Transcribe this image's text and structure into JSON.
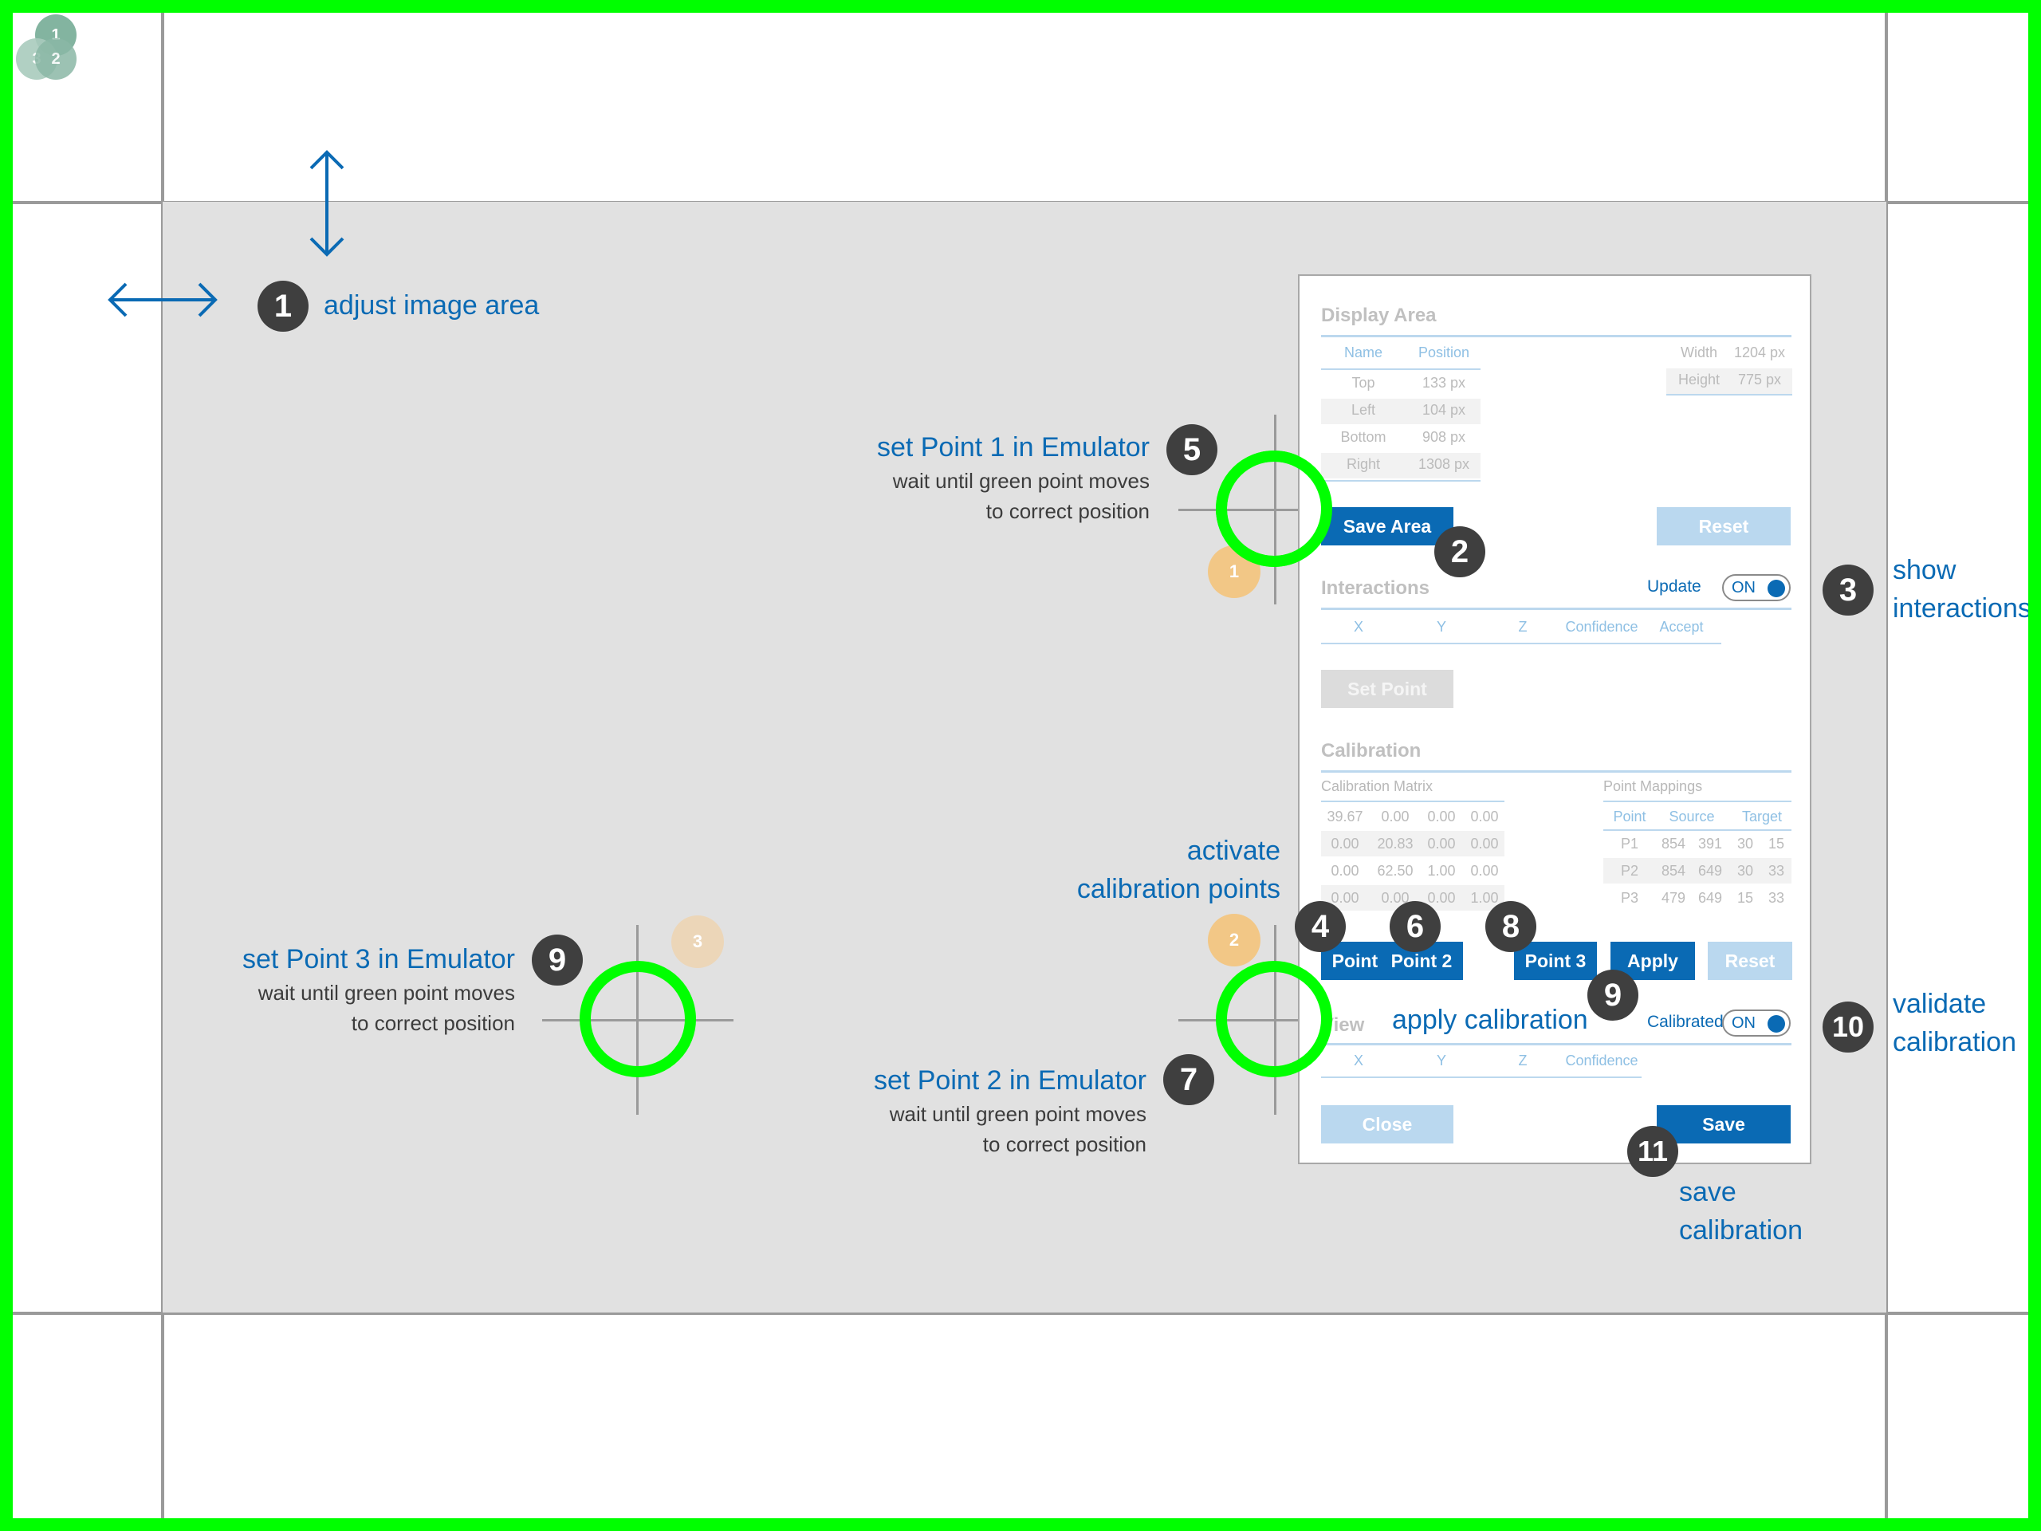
{
  "colors": {
    "accent": "#0a6ab4",
    "target": "#00ff00",
    "marker": "#3f3f3f",
    "calib_point": "#f2c786"
  },
  "corner_points": [
    "1",
    "3",
    "2"
  ],
  "steps": {
    "s1": {
      "num": "1",
      "title": "adjust image area"
    },
    "s2": {
      "num": "2"
    },
    "s3": {
      "num": "3",
      "title_l1": "show",
      "title_l2": "interactions"
    },
    "s4": {
      "num": "4"
    },
    "s5": {
      "num": "5",
      "title": "set Point 1 in Emulator",
      "sub_l1": "wait until green point moves",
      "sub_l2": "to correct position"
    },
    "s6": {
      "num": "6"
    },
    "s7": {
      "num": "7",
      "title": "set Point 2 in Emulator",
      "sub_l1": "wait until green point moves",
      "sub_l2": "to correct position"
    },
    "s8": {
      "num": "8"
    },
    "s9a": {
      "num": "9",
      "title": "set Point 3 in Emulator",
      "sub_l1": "wait until green point moves",
      "sub_l2": "to correct position"
    },
    "s9b": {
      "num": "9",
      "title": "apply calibration"
    },
    "s10": {
      "num": "10",
      "title_l1": "validate",
      "title_l2": "calibration"
    },
    "s11": {
      "num": "11",
      "title_l1": "save",
      "title_l2": "calibration"
    },
    "activate": {
      "l1": "activate",
      "l2": "calibration points"
    }
  },
  "calib_markers": [
    "1",
    "2",
    "3"
  ],
  "panel": {
    "display_area": {
      "title": "Display Area",
      "headers": [
        "Name",
        "Position"
      ],
      "rows": [
        [
          "Top",
          "133 px"
        ],
        [
          "Left",
          "104 px"
        ],
        [
          "Bottom",
          "908 px"
        ],
        [
          "Right",
          "1308 px"
        ]
      ],
      "size": [
        [
          "Width",
          "1204 px"
        ],
        [
          "Height",
          "775 px"
        ]
      ],
      "save_button": "Save Area",
      "reset_button": "Reset"
    },
    "interactions": {
      "title": "Interactions",
      "update_label": "Update",
      "toggle": "ON",
      "headers": [
        "X",
        "Y",
        "Z",
        "Confidence",
        "Accept"
      ],
      "set_point_button": "Set Point"
    },
    "calibration": {
      "title": "Calibration",
      "matrix_label": "Calibration Matrix",
      "matrix": [
        [
          "39.67",
          "0.00",
          "0.00",
          "0.00"
        ],
        [
          "0.00",
          "20.83",
          "0.00",
          "0.00"
        ],
        [
          "0.00",
          "62.50",
          "1.00",
          "0.00"
        ],
        [
          "0.00",
          "0.00",
          "0.00",
          "1.00"
        ]
      ],
      "mappings_label": "Point Mappings",
      "mapping_headers": [
        "Point",
        "Source",
        "Target"
      ],
      "mappings": [
        [
          "P1",
          "854",
          "391",
          "30",
          "15"
        ],
        [
          "P2",
          "854",
          "649",
          "30",
          "33"
        ],
        [
          "P3",
          "479",
          "649",
          "15",
          "33"
        ]
      ],
      "point1": "Point 1",
      "point2": "Point 2",
      "point3": "Point 3",
      "apply": "Apply",
      "reset": "Reset"
    },
    "view": {
      "title": "View",
      "calibrated_label": "Calibrated",
      "toggle": "ON",
      "headers": [
        "X",
        "Y",
        "Z",
        "Confidence"
      ],
      "close_button": "Close",
      "save_button": "Save"
    }
  }
}
